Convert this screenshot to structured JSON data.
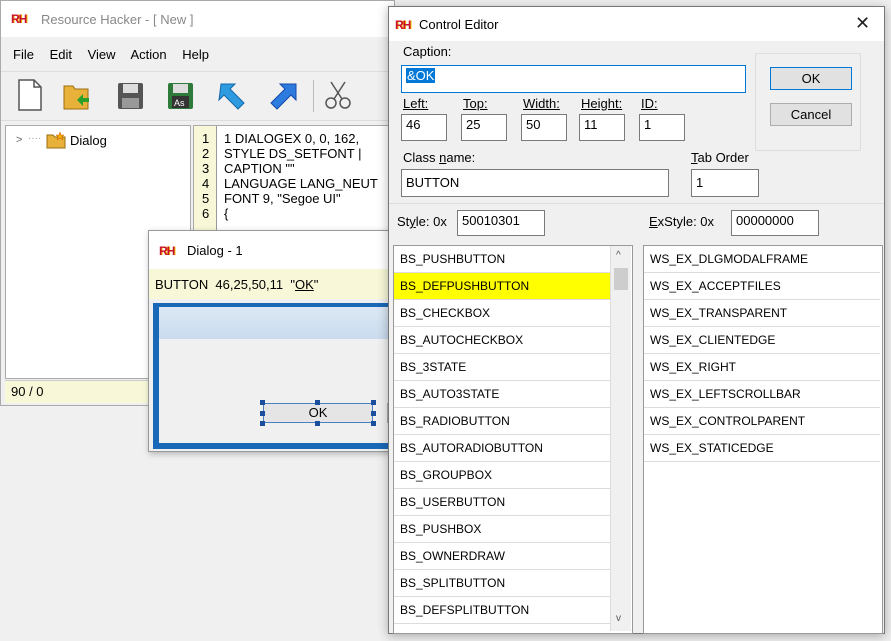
{
  "main_window": {
    "title": "Resource Hacker - [ New ]",
    "menu": [
      "File",
      "Edit",
      "View",
      "Action",
      "Help"
    ],
    "tree_item": "Dialog",
    "status": "90 / 0",
    "code": {
      "line_numbers": [
        "1",
        "2",
        "3",
        "4",
        "5",
        "6"
      ],
      "lines": [
        "1 DIALOGEX 0, 0, 162,",
        "STYLE DS_SETFONT |",
        "CAPTION \"\"",
        "LANGUAGE LANG_NEUT",
        "FONT 9, \"Segoe UI\"",
        "{"
      ]
    }
  },
  "dialog_preview": {
    "title": "Dialog - 1",
    "info_prefix": "BUTTON  46,25,50,11  \"",
    "info_ok": "OK",
    "info_suffix": "\"",
    "button_label": "OK"
  },
  "control_editor": {
    "title": "Control Editor",
    "caption_label": "Caption:",
    "caption_value": "&OK",
    "left_label": "Left:",
    "left_value": "46",
    "top_label": "Top:",
    "top_value": "25",
    "width_label": "Width:",
    "width_value": "50",
    "height_label": "Height:",
    "height_value": "11",
    "id_label": "ID:",
    "id_value": "1",
    "classname_label": "Class name:",
    "classname_value": "BUTTON",
    "taborder_label": "Tab Order",
    "taborder_value": "1",
    "ok_label": "OK",
    "cancel_label": "Cancel",
    "style_label": "Style:  0x",
    "style_value": "50010301",
    "exstyle_label": "ExStyle:  0x",
    "exstyle_value": "00000000",
    "styles": [
      "BS_PUSHBUTTON",
      "BS_DEFPUSHBUTTON",
      "BS_CHECKBOX",
      "BS_AUTOCHECKBOX",
      "BS_3STATE",
      "BS_AUTO3STATE",
      "BS_RADIOBUTTON",
      "BS_AUTORADIOBUTTON",
      "BS_GROUPBOX",
      "BS_USERBUTTON",
      "BS_PUSHBOX",
      "BS_OWNERDRAW",
      "BS_SPLITBUTTON",
      "BS_DEFSPLITBUTTON"
    ],
    "selected_style_index": 1,
    "exstyles": [
      "WS_EX_DLGMODALFRAME",
      "WS_EX_ACCEPTFILES",
      "WS_EX_TRANSPARENT",
      "WS_EX_CLIENTEDGE",
      "WS_EX_RIGHT",
      "WS_EX_LEFTSCROLLBAR",
      "WS_EX_CONTROLPARENT",
      "WS_EX_STATICEDGE"
    ],
    "highlight_color": "#ffff00",
    "selection_color": "#0078d7"
  }
}
